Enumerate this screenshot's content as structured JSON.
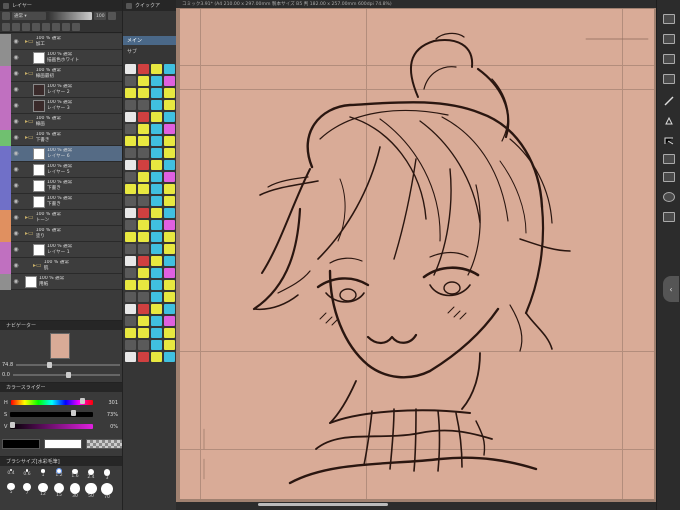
{
  "left_panel": {
    "layer_tab": "レイヤー",
    "blend_mode": "通常",
    "opacity_value": "100",
    "layers": [
      {
        "opacity": "100 % 通常",
        "name": "加工",
        "type": "folder",
        "color": "#8f8f8f",
        "indent": 0,
        "thumb": "none"
      },
      {
        "opacity": "100 % 通常",
        "name": "描画色ホワイト",
        "type": "layer",
        "color": "#8f8f8f",
        "indent": 8,
        "thumb": "white"
      },
      {
        "opacity": "100 % 通常",
        "name": "線画最初",
        "type": "folder",
        "color": "#c070c0",
        "indent": 0,
        "thumb": "none"
      },
      {
        "opacity": "100 % 通常",
        "name": "レイヤー 2",
        "type": "layer",
        "color": "#c070c0",
        "indent": 8,
        "thumb": "dark"
      },
      {
        "opacity": "100 % 通常",
        "name": "レイヤー 3",
        "type": "layer",
        "color": "#c070c0",
        "indent": 8,
        "thumb": "dark"
      },
      {
        "opacity": "100 % 通常",
        "name": "線画",
        "type": "folder",
        "color": "#c070c0",
        "indent": 0,
        "thumb": "none"
      },
      {
        "opacity": "100 % 通常",
        "name": "下書き",
        "type": "folder",
        "color": "#70c070",
        "indent": 0,
        "thumb": "none"
      },
      {
        "opacity": "100 % 通常",
        "name": "レイヤー 6",
        "type": "layer",
        "color": "#7070c8",
        "indent": 8,
        "thumb": "white",
        "active": true
      },
      {
        "opacity": "100 % 通常",
        "name": "レイヤー 5",
        "type": "layer",
        "color": "#7070c8",
        "indent": 8,
        "thumb": "white"
      },
      {
        "opacity": "100 % 通常",
        "name": "下書き",
        "type": "layer",
        "color": "#7070c8",
        "indent": 8,
        "thumb": "white"
      },
      {
        "opacity": "100 % 通常",
        "name": "下書き",
        "type": "layer",
        "color": "#7070c8",
        "indent": 8,
        "thumb": "white"
      },
      {
        "opacity": "100 % 通常",
        "name": "トーン",
        "type": "folder",
        "color": "#e09060",
        "indent": 0,
        "thumb": "none"
      },
      {
        "opacity": "100 % 通常",
        "name": "塗り",
        "type": "folder",
        "color": "#e09060",
        "indent": 0,
        "thumb": "none"
      },
      {
        "opacity": "100 % 通常",
        "name": "レイヤー 1",
        "type": "layer",
        "color": "#c070c0",
        "indent": 8,
        "thumb": "white"
      },
      {
        "opacity": "100 % 通常",
        "name": "肌",
        "type": "folder",
        "color": "#c070c0",
        "indent": 8,
        "thumb": "none"
      },
      {
        "opacity": "100 % 通常",
        "name": "用紙",
        "type": "layer",
        "color": "#8f8f8f",
        "indent": 0,
        "thumb": "white"
      }
    ]
  },
  "navigator": {
    "tab": "ナビゲーター",
    "zoom": "74.8",
    "rotation": "0.0",
    "zoom_fraction": 0.3,
    "rotation_fraction": 0.5
  },
  "color_slider": {
    "tab": "カラースライダー",
    "rows": [
      {
        "label": "H",
        "value": "301",
        "fraction": 0.84
      },
      {
        "label": "S",
        "value": "73%",
        "fraction": 0.73
      },
      {
        "label": "V",
        "value": "0%",
        "fraction": 0.0
      }
    ],
    "main_color": "#000000",
    "sub_color": "#ffffff"
  },
  "brush_size": {
    "tab": "ブラシサイズ[水彩毛筆]",
    "sizes": [
      "0.4",
      "0.6",
      "1",
      "1.2",
      "1.6",
      "2.4",
      "3",
      "5",
      "7",
      "12",
      "15",
      "30",
      "50",
      "70"
    ],
    "selected": "1.2"
  },
  "tool_panel": {
    "tab": "クイックア",
    "main_label": "メイン",
    "sub_label": "サブ"
  },
  "canvas": {
    "title": "コミック3.91* (A4 210.00 x 297.00mm 製本サイズ B5 判 182.00 x 257.00mm 600dpi 74.8%)"
  },
  "colors": {
    "paper": "#d9ab97",
    "canvas_bg": "#a08170",
    "active_layer": "#556b85"
  }
}
